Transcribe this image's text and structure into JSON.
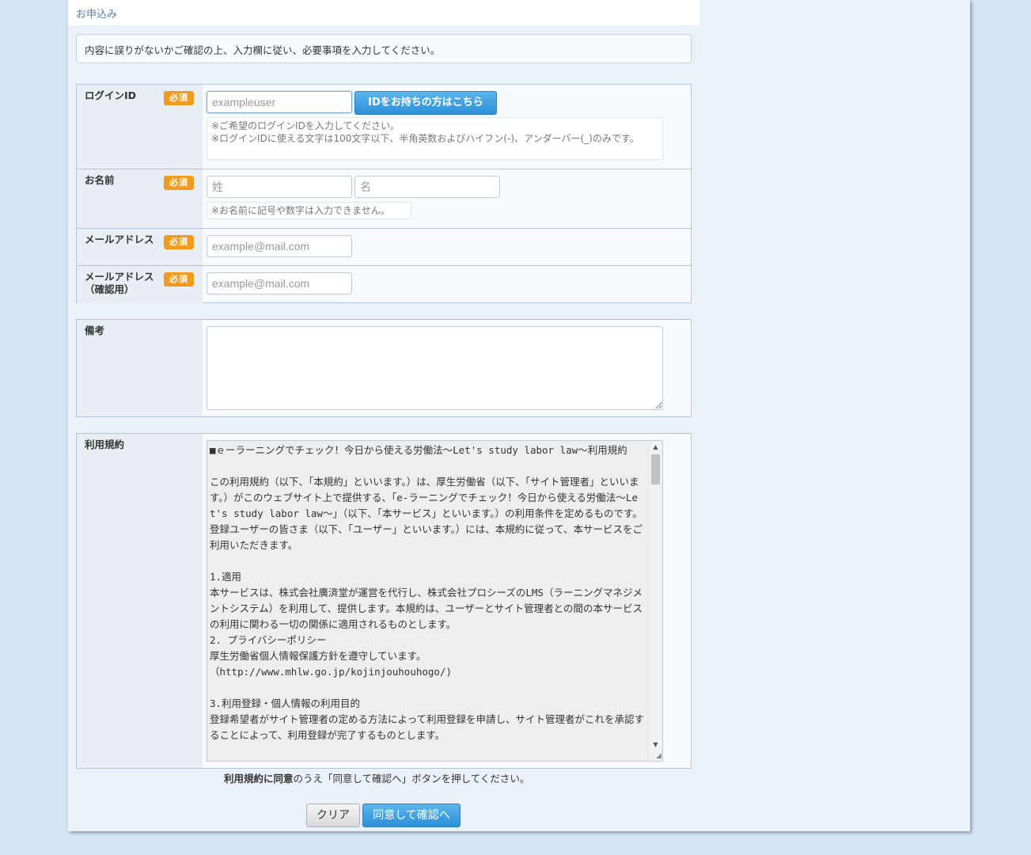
{
  "header": {
    "title": "お申込み"
  },
  "notice": "内容に誤りがないかご確認の上、入力欄に従い、必要事項を入力してください。",
  "required_badge": "必須",
  "login": {
    "label": "ログインID",
    "placeholder": "exampleuser",
    "button": "IDをお持ちの方はこちら",
    "hint1": "※ご希望のログインIDを入力してください。",
    "hint2": "※ログインIDに使える文字は100文字以下、半角英数およびハイフン(-)、アンダーバー(_)のみです。"
  },
  "name": {
    "label": "お名前",
    "last_placeholder": "姓",
    "first_placeholder": "名",
    "hint": "※お名前に記号や数字は入力できません。"
  },
  "email": {
    "label": "メールアドレス",
    "placeholder": "example@mail.com"
  },
  "email_confirm": {
    "label": "メールアドレス",
    "sublabel": "（確認用）",
    "placeholder": "example@mail.com"
  },
  "memo": {
    "label": "備考"
  },
  "terms": {
    "label": "利用規約",
    "text": "■ｅーラーニングでチェック！今日から使える労働法～Let's study labor law～利用規約\n\nこの利用規約（以下、「本規約」といいます。）は、厚生労働省（以下、「サイト管理者」といいます。）がこのウェブサイト上で提供する、「e-ラーニングでチェック！今日から使える労働法～Let's study labor law～」（以下、「本サービス」といいます。）の利用条件を定めるものです。登録ユーザーの皆さま（以下、「ユーザー」といいます。）には、本規約に従って、本サービスをご利用いただきます。\n\n1.適用\n本サービスは、株式会社廣済堂が運営を代行し、株式会社プロシーズのLMS（ラーニングマネジメントシステム）を利用して、提供します。本規約は、ユーザーとサイト管理者との間の本サービスの利用に関わる一切の関係に適用されるものとします。\n2. プライバシーポリシー\n厚生労働省個人情報保護方針を遵守しています。\n（http://www.mhlw.go.jp/kojinjouhouhogo/)\n\n3.利用登録・個人情報の利用目的\n登録希望者がサイト管理者の定める方法によって利用登録を申請し、サイト管理者がこれを承認することによって、利用登録が完了するものとします。"
  },
  "agree_message": {
    "bold": "利用規約に同意",
    "rest": "のうえ「同意して確認へ」ボタンを押してください。"
  },
  "buttons": {
    "clear": "クリア",
    "agree": "同意して確認へ"
  }
}
